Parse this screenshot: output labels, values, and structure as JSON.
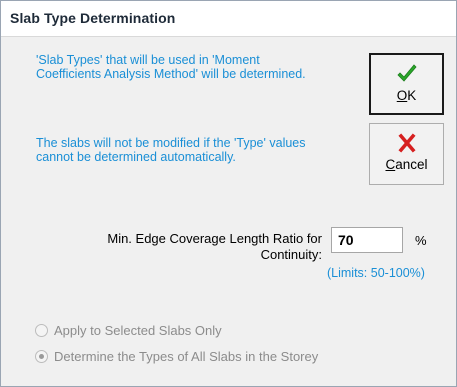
{
  "window": {
    "title": "Slab Type Determination"
  },
  "info": {
    "paragraph1": "'Slab Types' that will be used in 'Moment Coefficients Analysis Method' will be determined.",
    "paragraph2": "The slabs will not be modified if the 'Type' values cannot be determined automatically."
  },
  "buttons": {
    "ok": {
      "label_hotkey": "O",
      "label_rest": "K",
      "icon": "check-mark-icon",
      "is_default": true
    },
    "cancel": {
      "label_hotkey": "C",
      "label_rest": "ancel",
      "icon": "red-x-icon"
    }
  },
  "ratio": {
    "label_line1": "Min. Edge Coverage Length Ratio for",
    "label_line2": "Continuity:",
    "value": "70",
    "unit": "%",
    "limits": "(Limits: 50-100%)"
  },
  "scope": {
    "options": [
      {
        "label": "Apply to Selected Slabs Only",
        "checked": false,
        "enabled": false
      },
      {
        "label": "Determine the Types of All Slabs in the Storey",
        "checked": true,
        "enabled": false
      }
    ]
  },
  "colors": {
    "info_text": "#1a8fd6",
    "check_green": "#2aa72a",
    "cancel_red": "#d62020",
    "disabled_text": "#8c8c8c"
  }
}
